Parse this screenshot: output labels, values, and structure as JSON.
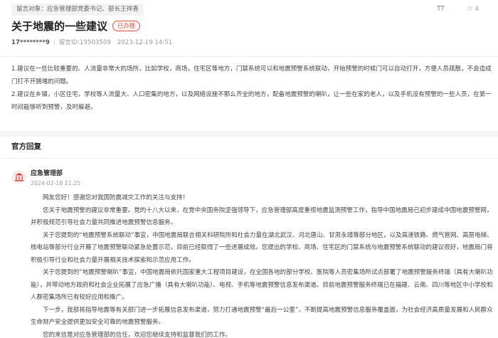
{
  "header": {
    "recipient": "留言对象：应急管理部党委书记、部长王祥喜",
    "font_toggle_label": "TT",
    "favorite_count": "4"
  },
  "message": {
    "title": "关于地震的一些建议",
    "status": "已办理",
    "user": "17********9",
    "message_id": "留言ID:19503509",
    "timestamp": "2023-12-19 14:51",
    "paragraphs": [
      "1.建议在一些比较重要的、人流量非常大的场所，比如学校，商场，住宅区等地方，门禁系统可以和地震预警系统联动，开始预警的时候门可以自动打开，方便人员疏散，不会造成门打不开拥堵的问题。",
      "2.建议在乡镇，小区住宅，学校等人流量大、人口密集的地方，以及网络设施不那么齐全的地方，配备地震预警的喇叭，让一些在家的老人，以及手机没有预警的一些人员，在第一时间能够听到预警，及时躲避。"
    ]
  },
  "official_reply": {
    "heading": "官方回复",
    "org_name": "应急管理部",
    "date": "2024-02-18 11:25",
    "paragraphs": [
      "网友您好！感谢您对我国防震减灾工作的关注与支持！",
      "您关于地震预警的建议非常重要。党的十八大以来，在党中央国务院坚强领导下，应急管理部高度重视地震监测预警工作，指导中国地震局已初步建成中国地震预警网，并积极规范引导社会力量共同推进地震预警信息服务。",
      "关于您提到的“地震预警系统联动”事宜，中国地震局联合相关科研院所和社会力量在湖北武汉、河北唐山、甘肃永靖等部分地区，以及高速铁路、燃气管网、高层电梯、核电站等部分行业开展了地震预警联动紧急处置示范，目前已经取得了一些进展成效。您提出的学校、商场、住宅区的门禁系统与地震预警系统联动的建议很好，地震局门将积极引导行业和社会力量开展相关技术探索和示范应用工作。",
      "关于您提到的“地震预警喇叭”事宜，中国地震局依托国家重大工程项目建设，在全国各地的部分学校、医院等人员密集场所试点部署了地震预警服务终端（具有大喇叭功能），并带动地方政府和社会企业拓展了应急广播（具有大喇叭功能）、电视、手机等地震预警信息发布渠道。目前地震预警服务终端已在福建、云南、四川等地区中小学校和人群密集场所已有较好应用和推广。",
      "下一步，我部将指导地震等有关部门进一步拓展信息发布渠道，努力打通地震预警“最后一公里”，不断提高地震预警信息服务覆盖面，为社会经济高质量发展和人民群众生命财产安全提供更加安全可靠的地震预警服务。",
      "您的来信是对应急管理部的信任，欢迎您继续支持和监督我们的工作。"
    ]
  }
}
